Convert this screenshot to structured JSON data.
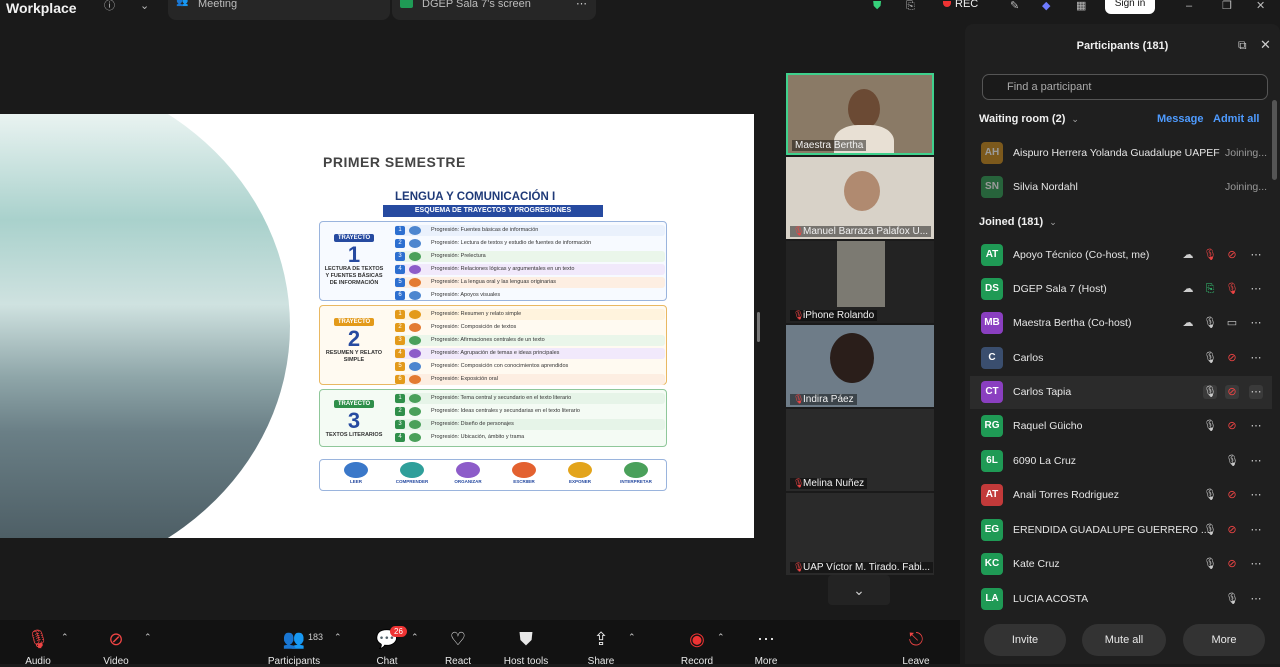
{
  "topbar": {
    "app_title": "Workplace",
    "tab_meeting": "Meeting",
    "tab_screen": "DGEP Sala 7's screen",
    "rec_label": "REC",
    "signin_label": "Sign in"
  },
  "slide": {
    "heading": "PRIMER SEMESTRE",
    "title": "LENGUA Y COMUNICACIÓN I",
    "subtitle": "ESQUEMA DE TRAYECTOS Y PROGRESIONES",
    "trayectos": [
      {
        "tag": "TRAYECTO",
        "num": "1",
        "name": "LECTURA DE TEXTOS Y FUENTES BÁSICAS DE INFORMACIÓN",
        "progresiones": [
          "Progresión: Fuentes básicas de información",
          "Progresión: Lectura de textos y estudio de fuentes de información",
          "Progresión: Prelectura",
          "Progresión: Relaciones lógicas y argumentales en un texto",
          "Progresión: La lengua oral y las lenguas originarias",
          "Progresión: Apoyos visuales"
        ]
      },
      {
        "tag": "TRAYECTO",
        "num": "2",
        "name": "RESUMEN Y RELATO SIMPLE",
        "progresiones": [
          "Progresión: Resumen y relato simple",
          "Progresión: Composición de textos",
          "Progresión: Afirmaciones centrales de un texto",
          "Progresión: Agrupación de temas e ideas principales",
          "Progresión: Composición con conocimientos aprendidos",
          "Progresión: Exposición oral"
        ]
      },
      {
        "tag": "TRAYECTO",
        "num": "3",
        "name": "TEXTOS LITERARIOS",
        "progresiones": [
          "Progresión: Tema central y secundario en el texto literario",
          "Progresión: Ideas centrales y secundarias en el texto literario",
          "Progresión: Diseño de personajes",
          "Progresión: Ubicación, ámbito y trama"
        ]
      }
    ],
    "proceso": [
      "LEER",
      "COMPRENDER",
      "ORGANIZAR",
      "ESCRIBIR",
      "EXPONER",
      "INTERPRETAR"
    ]
  },
  "videos": [
    {
      "name": "Maestra Bertha",
      "muted": false
    },
    {
      "name": "Manuel Barraza Palafox U...",
      "muted": true
    },
    {
      "name": "iPhone Rolando",
      "muted": true
    },
    {
      "name": "Indira Páez",
      "muted": true
    },
    {
      "name": "Melina Nuñez",
      "muted": true
    },
    {
      "name": "UAP Víctor M. Tirado. Fabi...",
      "muted": true
    }
  ],
  "panel": {
    "title": "Participants (181)",
    "search_placeholder": "Find a participant",
    "waiting_label": "Waiting room (2)",
    "message_label": "Message",
    "admit_all_label": "Admit all",
    "joined_label": "Joined (181)",
    "waiting": [
      {
        "initials": "AH",
        "name": "Aispuro Herrera Yolanda Guadalupe UAPEF",
        "status": "Joining...",
        "color": "#c98a1a"
      },
      {
        "initials": "SN",
        "name": "Silvia Nordahl",
        "status": "Joining...",
        "color": "#2f9b53"
      }
    ],
    "joined": [
      {
        "initials": "AT",
        "name": "Apoyo Técnico (Co-host, me)",
        "color": "#1f9a55"
      },
      {
        "initials": "DS",
        "name": "DGEP Sala 7 (Host)",
        "color": "#1f9a55"
      },
      {
        "initials": "MB",
        "name": "Maestra Bertha (Co-host)",
        "color": "#8a3fc0"
      },
      {
        "initials": "C",
        "name": "Carlos",
        "color": "#3a4e6e"
      },
      {
        "initials": "CT",
        "name": "Carlos Tapia",
        "color": "#8a3fc0"
      },
      {
        "initials": "RG",
        "name": "Raquel Güicho",
        "color": "#1f9a55"
      },
      {
        "initials": "6L",
        "name": "6090 La Cruz",
        "color": "#1f9a55"
      },
      {
        "initials": "AT",
        "name": "Anali Torres Rodriguez",
        "color": "#c23a3a"
      },
      {
        "initials": "EG",
        "name": "ERENDIDA GUADALUPE GUERRERO ...",
        "color": "#1f9a55"
      },
      {
        "initials": "KC",
        "name": "Kate Cruz",
        "color": "#1f9a55"
      },
      {
        "initials": "LA",
        "name": "LUCIA ACOSTA",
        "color": "#1f9a55"
      }
    ],
    "invite_label": "Invite",
    "mute_all_label": "Mute all",
    "more_label": "More"
  },
  "toolbar": {
    "audio": "Audio",
    "video": "Video",
    "participants": "Participants",
    "participants_count": "183",
    "chat": "Chat",
    "chat_badge": "26",
    "react": "React",
    "host_tools": "Host tools",
    "share": "Share",
    "record": "Record",
    "more": "More",
    "leave": "Leave"
  }
}
